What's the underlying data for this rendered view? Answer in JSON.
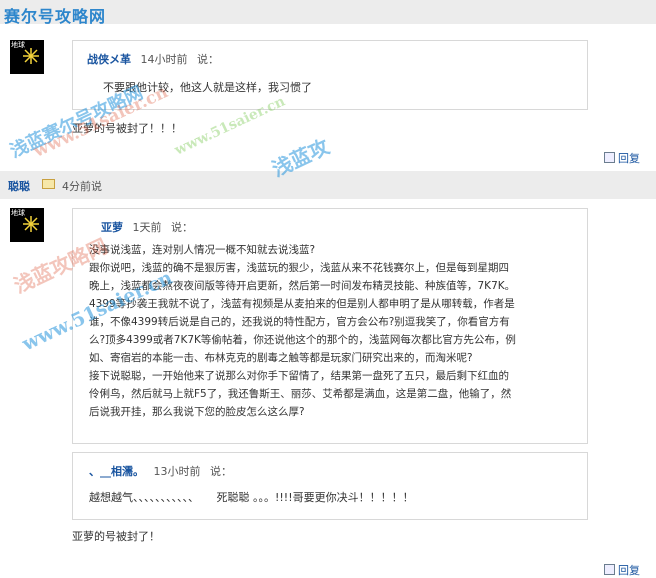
{
  "site": {
    "logo": "赛尔号攻略网"
  },
  "post1": {
    "author": "战侠メ革",
    "time": "14小时前",
    "says": "说：",
    "quote": "不要跟他计较，他这人就是这样，我习惯了",
    "reply_text": "亚萝的号被封了！！！",
    "reply_link": "回复"
  },
  "user_bar": {
    "name": "聪聪",
    "time": "4分前说"
  },
  "post2": {
    "author": "亚萝",
    "time": "1天前",
    "says": "说：",
    "paragraph_lines": [
      "没事说浅蓝，连对别人情况一概不知就去说浅蓝?",
      "跟你说吧，浅蓝的确不是狠厉害，浅蓝玩的狠少，浅蓝从来不花钱赛尔上，但是每到星期四",
      "晚上，浅蓝都会熬夜夜间版等待开启更新，然后第一时间发布精灵技能、种族值等，7K7K。",
      "4399等抄袭王我就不说了，浅蓝有视频是从麦拍来的但是别人都申明了是从哪转载，作者是",
      "谁，不像4399转后说是自己的，还我说的特性配方，官方会公布?别逗我笑了，你看官方有",
      "么?顶多4399或者7K7K等偷帖着，你还说他这个的那个的，浅蓝网每次都比官方先公布，例",
      "如、寄宿岩的本能一击、布林克克的剧毒之触等都是玩家门研究出来的，而淘米呢?",
      "接下说聪聪，一开始他来了说那么对你手下留情了，结果第一盘死了五只，最后剩下红血的",
      "伶俐鸟，然后就马上就F5了，我还鲁斯王、丽莎、艾希都是满血，这是第二盘，他输了，然",
      "后说我开挂，那么我说下您的脸皮怎么这么厚?"
    ]
  },
  "post3": {
    "author": "、__相濡。",
    "time": "13小时前",
    "says": "说：",
    "text": "越想越气、、、、、、、、、、、     死聪聪 。。。!!!!哥要更你决斗！！！！！"
  },
  "post4": {
    "reply_text": "亚萝的号被封了！",
    "reply_link": "回复"
  },
  "watermarks": [
    "浅蓝赛尔号攻略网",
    "www.51saier.cn",
    "浅蓝攻略网",
    "浅蓝攻"
  ]
}
